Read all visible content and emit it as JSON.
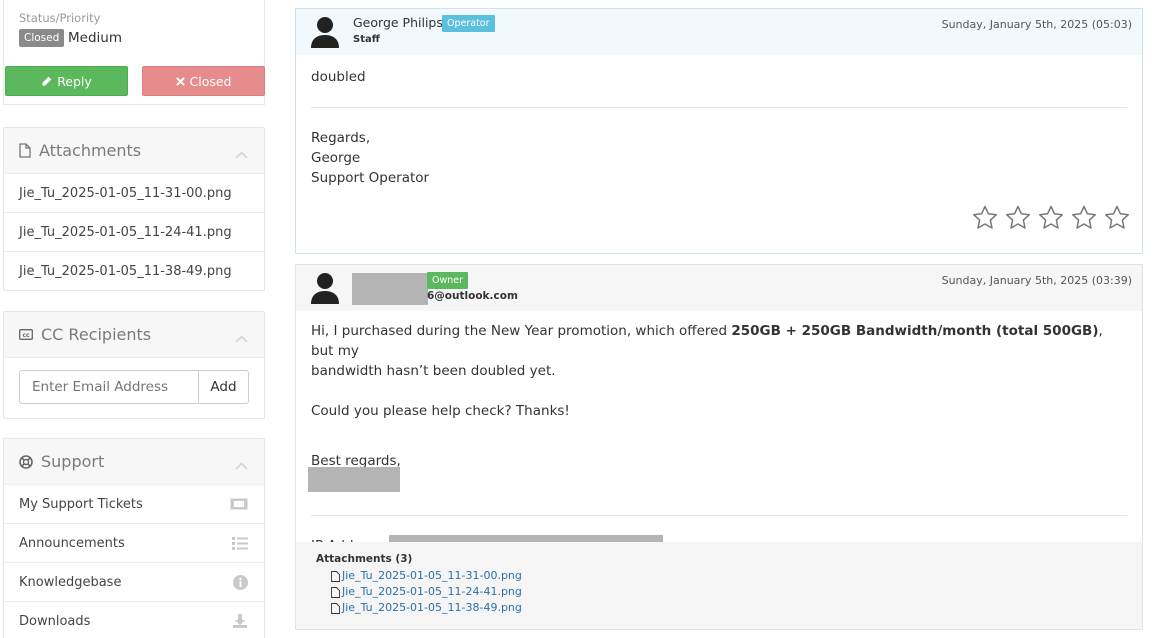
{
  "sidebar": {
    "status_label": "Status/Priority",
    "status_badge": "Closed",
    "priority": "Medium",
    "reply_button": "Reply",
    "closed_button": "Closed",
    "attachments": {
      "title": "Attachments",
      "items": [
        "Jie_Tu_2025-01-05_11-31-00.png",
        "Jie_Tu_2025-01-05_11-24-41.png",
        "Jie_Tu_2025-01-05_11-38-49.png"
      ]
    },
    "cc": {
      "title": "CC Recipients",
      "placeholder": "Enter Email Address",
      "add_button": "Add"
    },
    "support": {
      "title": "Support",
      "items": [
        {
          "label": "My Support Tickets",
          "icon": "ticket-icon"
        },
        {
          "label": "Announcements",
          "icon": "list-icon"
        },
        {
          "label": "Knowledgebase",
          "icon": "info-icon"
        },
        {
          "label": "Downloads",
          "icon": "download-icon"
        }
      ]
    }
  },
  "messages": [
    {
      "author": "George Philips",
      "tag": "Operator",
      "role": "Staff",
      "date": "Sunday, January 5th, 2025 (05:03)",
      "body": "doubled",
      "signature": [
        "Regards,",
        "George",
        "Support Operator"
      ],
      "rating_stars": 5
    },
    {
      "author_suffix": "6@outlook.com",
      "tag": "Owner",
      "date": "Sunday, January 5th, 2025 (03:39)",
      "line1_a": "Hi, I purchased during the New Year promotion, which offered ",
      "line1_bold": "250GB + 250GB Bandwidth/month (total 500GB)",
      "line1_b": ", but my",
      "line2": "bandwidth hasn’t been doubled yet.",
      "line3": "Could you please help check? Thanks!",
      "closing": "Best regards,",
      "ip_label": "IP Address:",
      "attachments_title": "Attachments (3)",
      "attachments": [
        "Jie_Tu_2025-01-05_11-31-00.png",
        "Jie_Tu_2025-01-05_11-24-41.png",
        "Jie_Tu_2025-01-05_11-38-49.png"
      ]
    }
  ],
  "colors": {
    "success": "#5cb85c",
    "danger_light": "#e78c8c",
    "info": "#5bc0de",
    "link": "#2a6fa8"
  }
}
